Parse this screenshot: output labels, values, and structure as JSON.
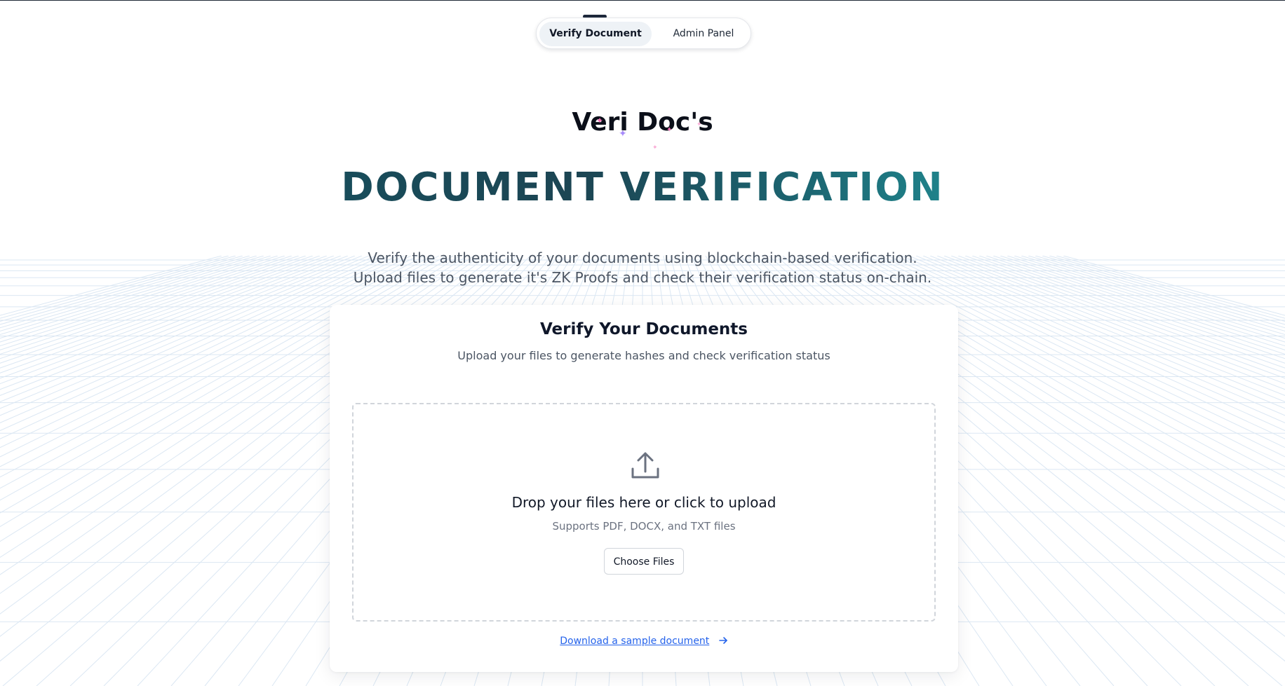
{
  "nav": {
    "tabs": [
      {
        "label": "Verify Document",
        "active": true
      },
      {
        "label": "Admin Panel",
        "active": false
      }
    ]
  },
  "brand": {
    "name": "Veri Doc's"
  },
  "hero": {
    "headline": "DOCUMENT VERIFICATION",
    "intro_line_1": "Verify the authenticity of your documents using blockchain-based verification.",
    "intro_line_2": "Upload files to generate it's ZK Proofs and check their verification status on-chain."
  },
  "card": {
    "title": "Verify Your Documents",
    "subtitle": "Upload your files to generate hashes and check verification status",
    "dropzone": {
      "icon": "upload-icon",
      "title": "Drop your files here or click to upload",
      "subtitle": "Supports PDF, DOCX, and TXT files",
      "button_label": "Choose Files"
    },
    "sample_link_label": "Download a sample document",
    "sample_link_icon": "arrow-right-icon"
  },
  "colors": {
    "headline_gradient_start": "#1b7c88",
    "headline_gradient_end": "#2aa9a6",
    "link": "#2563eb",
    "sparkle_pink": "#f472b6",
    "sparkle_purple": "#a78bfa"
  }
}
